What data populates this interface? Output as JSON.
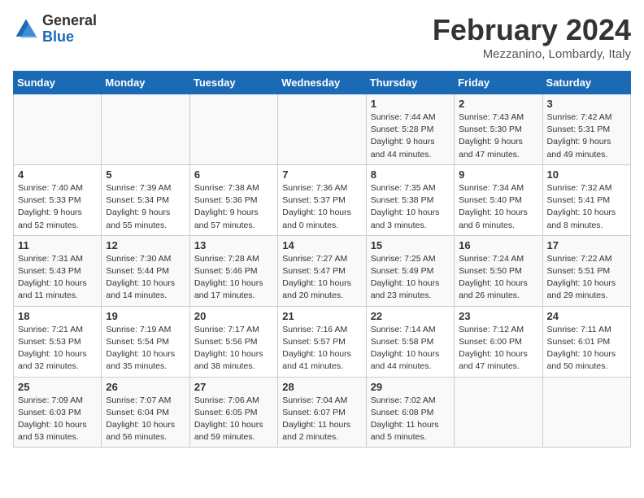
{
  "logo": {
    "general": "General",
    "blue": "Blue"
  },
  "title": "February 2024",
  "location": "Mezzanino, Lombardy, Italy",
  "days_of_week": [
    "Sunday",
    "Monday",
    "Tuesday",
    "Wednesday",
    "Thursday",
    "Friday",
    "Saturday"
  ],
  "weeks": [
    [
      {
        "day": "",
        "info": ""
      },
      {
        "day": "",
        "info": ""
      },
      {
        "day": "",
        "info": ""
      },
      {
        "day": "",
        "info": ""
      },
      {
        "day": "1",
        "info": "Sunrise: 7:44 AM\nSunset: 5:28 PM\nDaylight: 9 hours and 44 minutes."
      },
      {
        "day": "2",
        "info": "Sunrise: 7:43 AM\nSunset: 5:30 PM\nDaylight: 9 hours and 47 minutes."
      },
      {
        "day": "3",
        "info": "Sunrise: 7:42 AM\nSunset: 5:31 PM\nDaylight: 9 hours and 49 minutes."
      }
    ],
    [
      {
        "day": "4",
        "info": "Sunrise: 7:40 AM\nSunset: 5:33 PM\nDaylight: 9 hours and 52 minutes."
      },
      {
        "day": "5",
        "info": "Sunrise: 7:39 AM\nSunset: 5:34 PM\nDaylight: 9 hours and 55 minutes."
      },
      {
        "day": "6",
        "info": "Sunrise: 7:38 AM\nSunset: 5:36 PM\nDaylight: 9 hours and 57 minutes."
      },
      {
        "day": "7",
        "info": "Sunrise: 7:36 AM\nSunset: 5:37 PM\nDaylight: 10 hours and 0 minutes."
      },
      {
        "day": "8",
        "info": "Sunrise: 7:35 AM\nSunset: 5:38 PM\nDaylight: 10 hours and 3 minutes."
      },
      {
        "day": "9",
        "info": "Sunrise: 7:34 AM\nSunset: 5:40 PM\nDaylight: 10 hours and 6 minutes."
      },
      {
        "day": "10",
        "info": "Sunrise: 7:32 AM\nSunset: 5:41 PM\nDaylight: 10 hours and 8 minutes."
      }
    ],
    [
      {
        "day": "11",
        "info": "Sunrise: 7:31 AM\nSunset: 5:43 PM\nDaylight: 10 hours and 11 minutes."
      },
      {
        "day": "12",
        "info": "Sunrise: 7:30 AM\nSunset: 5:44 PM\nDaylight: 10 hours and 14 minutes."
      },
      {
        "day": "13",
        "info": "Sunrise: 7:28 AM\nSunset: 5:46 PM\nDaylight: 10 hours and 17 minutes."
      },
      {
        "day": "14",
        "info": "Sunrise: 7:27 AM\nSunset: 5:47 PM\nDaylight: 10 hours and 20 minutes."
      },
      {
        "day": "15",
        "info": "Sunrise: 7:25 AM\nSunset: 5:49 PM\nDaylight: 10 hours and 23 minutes."
      },
      {
        "day": "16",
        "info": "Sunrise: 7:24 AM\nSunset: 5:50 PM\nDaylight: 10 hours and 26 minutes."
      },
      {
        "day": "17",
        "info": "Sunrise: 7:22 AM\nSunset: 5:51 PM\nDaylight: 10 hours and 29 minutes."
      }
    ],
    [
      {
        "day": "18",
        "info": "Sunrise: 7:21 AM\nSunset: 5:53 PM\nDaylight: 10 hours and 32 minutes."
      },
      {
        "day": "19",
        "info": "Sunrise: 7:19 AM\nSunset: 5:54 PM\nDaylight: 10 hours and 35 minutes."
      },
      {
        "day": "20",
        "info": "Sunrise: 7:17 AM\nSunset: 5:56 PM\nDaylight: 10 hours and 38 minutes."
      },
      {
        "day": "21",
        "info": "Sunrise: 7:16 AM\nSunset: 5:57 PM\nDaylight: 10 hours and 41 minutes."
      },
      {
        "day": "22",
        "info": "Sunrise: 7:14 AM\nSunset: 5:58 PM\nDaylight: 10 hours and 44 minutes."
      },
      {
        "day": "23",
        "info": "Sunrise: 7:12 AM\nSunset: 6:00 PM\nDaylight: 10 hours and 47 minutes."
      },
      {
        "day": "24",
        "info": "Sunrise: 7:11 AM\nSunset: 6:01 PM\nDaylight: 10 hours and 50 minutes."
      }
    ],
    [
      {
        "day": "25",
        "info": "Sunrise: 7:09 AM\nSunset: 6:03 PM\nDaylight: 10 hours and 53 minutes."
      },
      {
        "day": "26",
        "info": "Sunrise: 7:07 AM\nSunset: 6:04 PM\nDaylight: 10 hours and 56 minutes."
      },
      {
        "day": "27",
        "info": "Sunrise: 7:06 AM\nSunset: 6:05 PM\nDaylight: 10 hours and 59 minutes."
      },
      {
        "day": "28",
        "info": "Sunrise: 7:04 AM\nSunset: 6:07 PM\nDaylight: 11 hours and 2 minutes."
      },
      {
        "day": "29",
        "info": "Sunrise: 7:02 AM\nSunset: 6:08 PM\nDaylight: 11 hours and 5 minutes."
      },
      {
        "day": "",
        "info": ""
      },
      {
        "day": "",
        "info": ""
      }
    ]
  ]
}
